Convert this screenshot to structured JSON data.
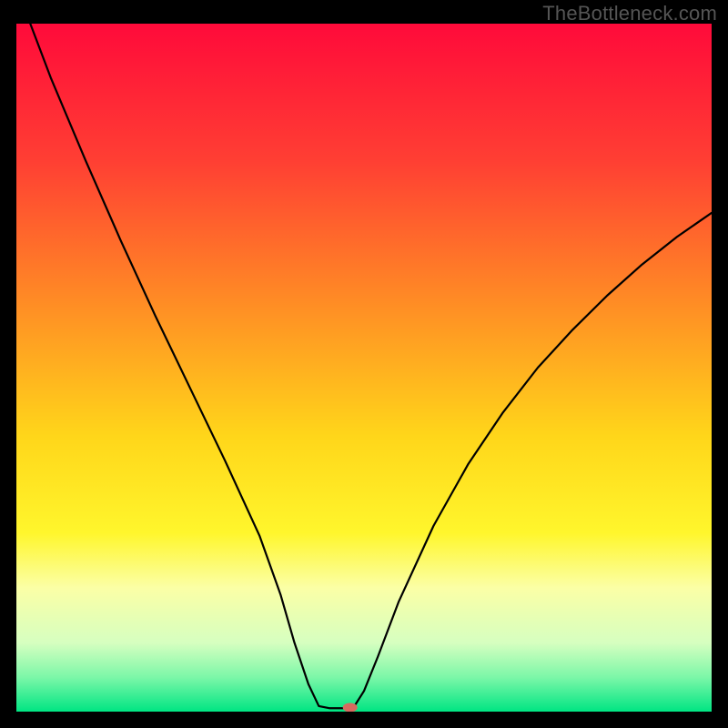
{
  "watermark": "TheBottleneck.com",
  "chart_data": {
    "type": "line",
    "title": "",
    "xlabel": "",
    "ylabel": "",
    "xlim": [
      0,
      100
    ],
    "ylim": [
      0,
      100
    ],
    "background": {
      "type": "vertical-gradient",
      "stops": [
        {
          "y": 0,
          "color": "#ff0a3a"
        },
        {
          "y": 20,
          "color": "#ff3f33"
        },
        {
          "y": 40,
          "color": "#ff8a25"
        },
        {
          "y": 60,
          "color": "#ffd61a"
        },
        {
          "y": 74,
          "color": "#fff62c"
        },
        {
          "y": 82,
          "color": "#fbffa6"
        },
        {
          "y": 90,
          "color": "#d6ffc0"
        },
        {
          "y": 95,
          "color": "#7cf7a8"
        },
        {
          "y": 100,
          "color": "#00e583"
        }
      ]
    },
    "curve": {
      "stroke": "#000000",
      "width": 2.2,
      "points": [
        {
          "x": 2.0,
          "y": 100.0
        },
        {
          "x": 5.0,
          "y": 92.0
        },
        {
          "x": 10.0,
          "y": 80.0
        },
        {
          "x": 15.0,
          "y": 68.5
        },
        {
          "x": 20.0,
          "y": 57.5
        },
        {
          "x": 25.0,
          "y": 47.0
        },
        {
          "x": 30.0,
          "y": 36.5
        },
        {
          "x": 35.0,
          "y": 25.5
        },
        {
          "x": 38.0,
          "y": 17.0
        },
        {
          "x": 40.0,
          "y": 10.0
        },
        {
          "x": 42.0,
          "y": 4.0
        },
        {
          "x": 43.5,
          "y": 0.8
        },
        {
          "x": 45.0,
          "y": 0.5
        },
        {
          "x": 47.0,
          "y": 0.5
        },
        {
          "x": 48.5,
          "y": 0.6
        },
        {
          "x": 50.0,
          "y": 3.0
        },
        {
          "x": 52.0,
          "y": 8.0
        },
        {
          "x": 55.0,
          "y": 16.0
        },
        {
          "x": 60.0,
          "y": 27.0
        },
        {
          "x": 65.0,
          "y": 36.0
        },
        {
          "x": 70.0,
          "y": 43.5
        },
        {
          "x": 75.0,
          "y": 50.0
        },
        {
          "x": 80.0,
          "y": 55.5
        },
        {
          "x": 85.0,
          "y": 60.5
        },
        {
          "x": 90.0,
          "y": 65.0
        },
        {
          "x": 95.0,
          "y": 69.0
        },
        {
          "x": 100.0,
          "y": 72.5
        }
      ]
    },
    "marker": {
      "x": 48.0,
      "y": 0.6,
      "rx": 8,
      "ry": 5,
      "fill": "#d76a5f"
    }
  }
}
